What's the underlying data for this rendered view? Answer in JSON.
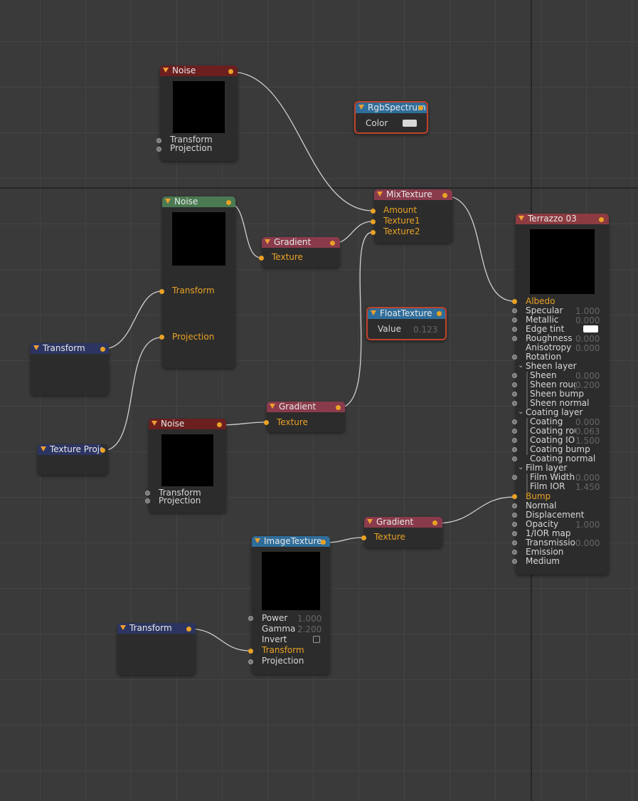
{
  "nodes": {
    "noise_top": {
      "title": "Noise",
      "rows": [
        "Transform",
        "Projection"
      ]
    },
    "rgb_spectrum": {
      "title": "RgbSpectrum",
      "color_label": "Color"
    },
    "noise_mid": {
      "title": "Noise",
      "rows": [
        "Transform",
        "Projection"
      ]
    },
    "gradient_top": {
      "title": "Gradient",
      "rows": [
        "Texture"
      ]
    },
    "mix_texture": {
      "title": "MixTexture",
      "rows": [
        "Amount",
        "Texture1",
        "Texture2"
      ]
    },
    "float_texture": {
      "title": "FloatTexture",
      "value_label": "Value",
      "value": "0.123"
    },
    "transform_left": {
      "title": "Transform"
    },
    "texture_proj": {
      "title": "Texture Projection"
    },
    "noise_low": {
      "title": "Noise",
      "rows": [
        "Transform",
        "Projection"
      ]
    },
    "gradient_mid": {
      "title": "Gradient",
      "rows": [
        "Texture"
      ]
    },
    "gradient_low": {
      "title": "Gradient",
      "rows": [
        "Texture"
      ]
    },
    "image_texture": {
      "title": "ImageTexture",
      "rows": [
        {
          "label": "Power",
          "value": "1.000"
        },
        {
          "label": "Gamma",
          "value": "2.200"
        },
        {
          "label": "Invert",
          "value": ""
        },
        {
          "label": "Transform",
          "value": ""
        },
        {
          "label": "Projection",
          "value": ""
        }
      ]
    },
    "transform_bottom": {
      "title": "Transform"
    },
    "terrazzo": {
      "title": "Terrazzo 03",
      "rows": [
        {
          "label": "Albedo",
          "value": ""
        },
        {
          "label": "Specular",
          "value": "1.000"
        },
        {
          "label": "Metallic",
          "value": "0.000"
        },
        {
          "label": "Edge tint",
          "value": ""
        },
        {
          "label": "Roughness",
          "value": "0.000"
        },
        {
          "label": "Anisotropy",
          "value": "0.000"
        },
        {
          "label": "Rotation",
          "value": ""
        },
        {
          "label": "Sheen layer",
          "value": ""
        },
        {
          "label": "Sheen",
          "value": "0.000"
        },
        {
          "label": "Sheen roughness",
          "value": "0.200"
        },
        {
          "label": "Sheen bump",
          "value": ""
        },
        {
          "label": "Sheen normal",
          "value": ""
        },
        {
          "label": "Coating layer",
          "value": ""
        },
        {
          "label": "Coating",
          "value": "0.000"
        },
        {
          "label": "Coating roughness",
          "value": "0.063"
        },
        {
          "label": "Coating IOR",
          "value": "1.500"
        },
        {
          "label": "Coating bump",
          "value": ""
        },
        {
          "label": "Coating normal",
          "value": ""
        },
        {
          "label": "Film layer",
          "value": ""
        },
        {
          "label": "Film Width",
          "value": "0.000"
        },
        {
          "label": "Film IOR",
          "value": "1.450"
        },
        {
          "label": "Bump",
          "value": ""
        },
        {
          "label": "Normal",
          "value": ""
        },
        {
          "label": "Displacement",
          "value": ""
        },
        {
          "label": "Opacity",
          "value": "1.000"
        },
        {
          "label": "1/IOR map",
          "value": ""
        },
        {
          "label": "Transmission",
          "value": "0.000"
        },
        {
          "label": "Emission",
          "value": ""
        },
        {
          "label": "Medium",
          "value": ""
        }
      ]
    }
  },
  "colors": {
    "wire": "#d0d0d0",
    "pin_connected": "#e9a225",
    "selected_border": "#c0432a",
    "grid_background": "#3a3a3a"
  }
}
